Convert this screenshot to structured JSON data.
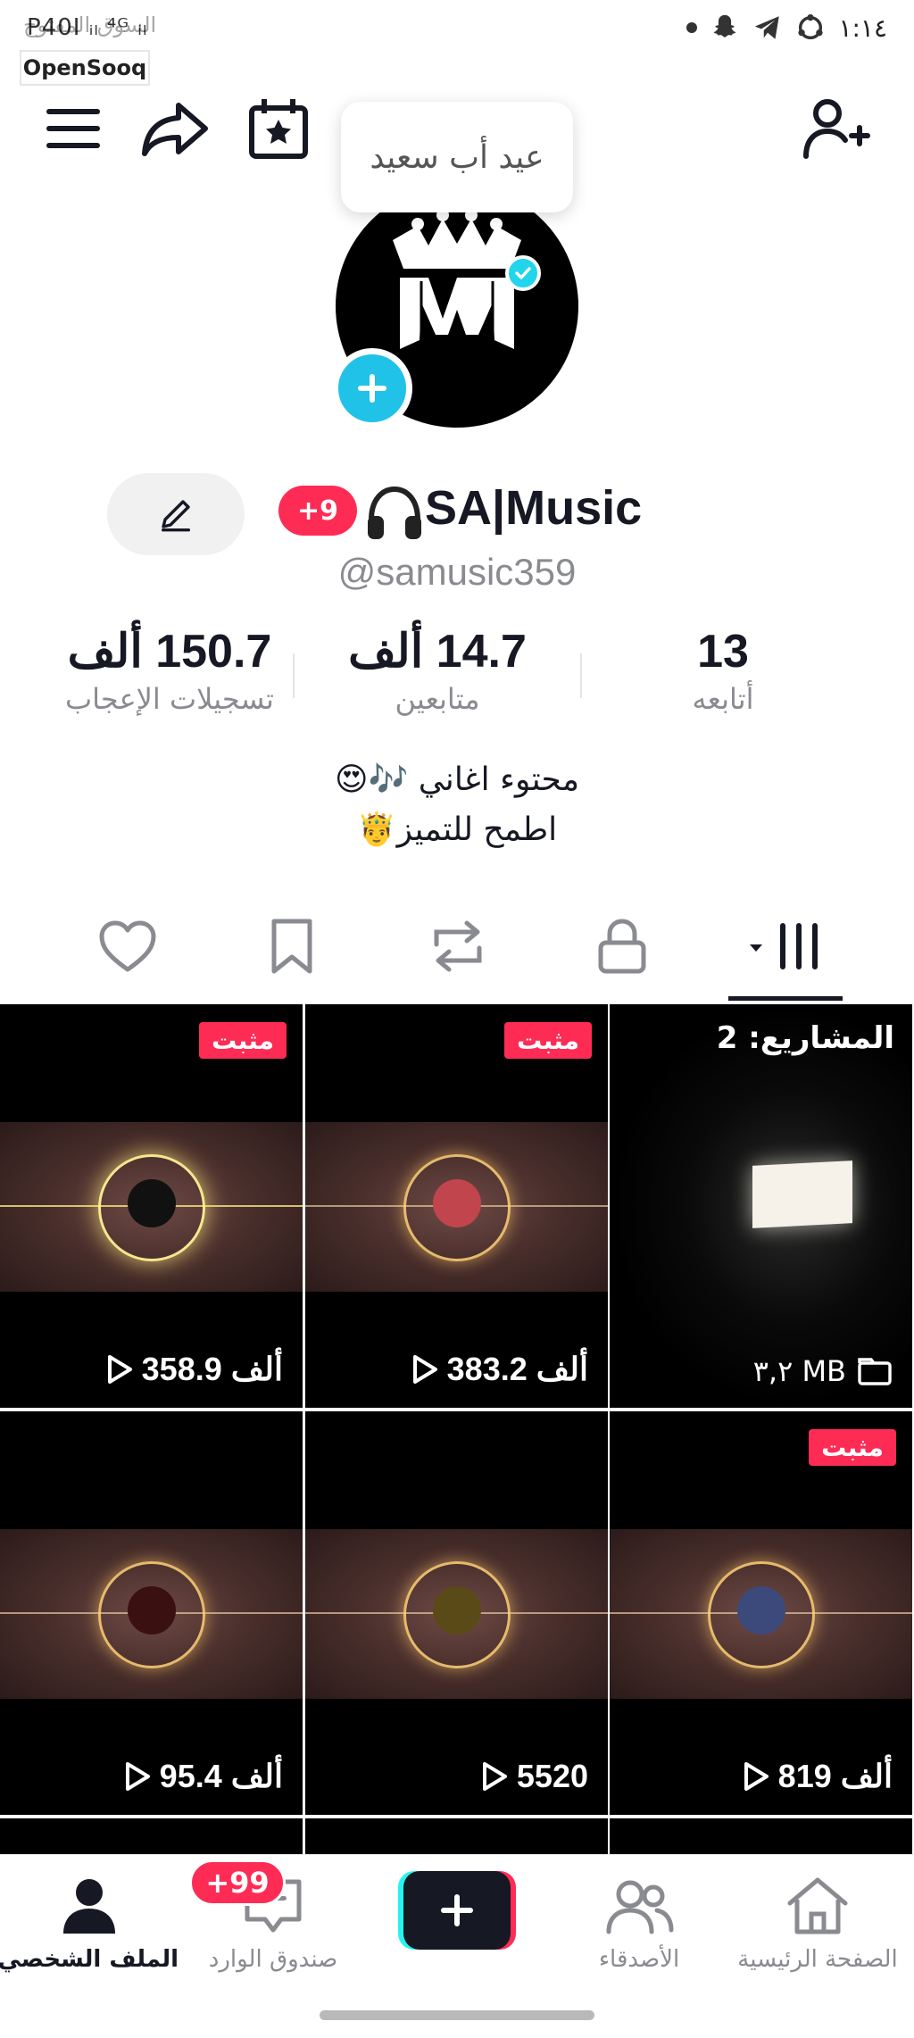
{
  "status_bar": {
    "left_text": "Ρ40Ⅰ ᵢₗ ⁴ᴳ ᵢₗ",
    "watermark": "السوق المفتوح",
    "opensooq": "OpenSooq",
    "time": "١:١٤"
  },
  "tooltip": "عيد أب سعيد",
  "profile": {
    "name": "SA|Music",
    "notif_badge": "+9",
    "handle": "@samusic359",
    "stats": [
      {
        "num": "13",
        "label": "أتابعه"
      },
      {
        "num": "14.7 ألف",
        "label": "متابعين"
      },
      {
        "num": "150.7 ألف",
        "label": "تسجيلات الإعجاب"
      }
    ],
    "bio_line1": "محتوء اغاني 🎶😍",
    "bio_line2": "اطمح للتميز🤴"
  },
  "tabs": [
    {
      "name": "videos",
      "icon": "grid-icon",
      "active": true
    },
    {
      "name": "private",
      "icon": "lock-icon"
    },
    {
      "name": "reposts",
      "icon": "repost-icon"
    },
    {
      "name": "favorites",
      "icon": "bookmark-icon"
    },
    {
      "name": "liked",
      "icon": "heart-icon"
    }
  ],
  "grid": {
    "pinned_label": "مثبت",
    "drafts": {
      "title": "المشاريع: 2",
      "size": "٣,٢ MB"
    },
    "videos": [
      {
        "views": "383.2 ألف",
        "pinned": true
      },
      {
        "views": "358.9 ألف",
        "pinned": true
      },
      {
        "views": "819 ألف",
        "pinned": true
      },
      {
        "views": "5520",
        "pinned": false
      },
      {
        "views": "95.4 ألف",
        "pinned": false
      }
    ]
  },
  "bottom_nav": {
    "home": "الصفحة الرئيسية",
    "friends": "الأصدقاء",
    "inbox": "صندوق الوارد",
    "inbox_badge": "+99",
    "profile": "الملف الشخصي"
  },
  "colors": {
    "accent": "#fe2c55",
    "cyan": "#25f4ee",
    "text": "#161823",
    "muted": "#8a8b91"
  }
}
